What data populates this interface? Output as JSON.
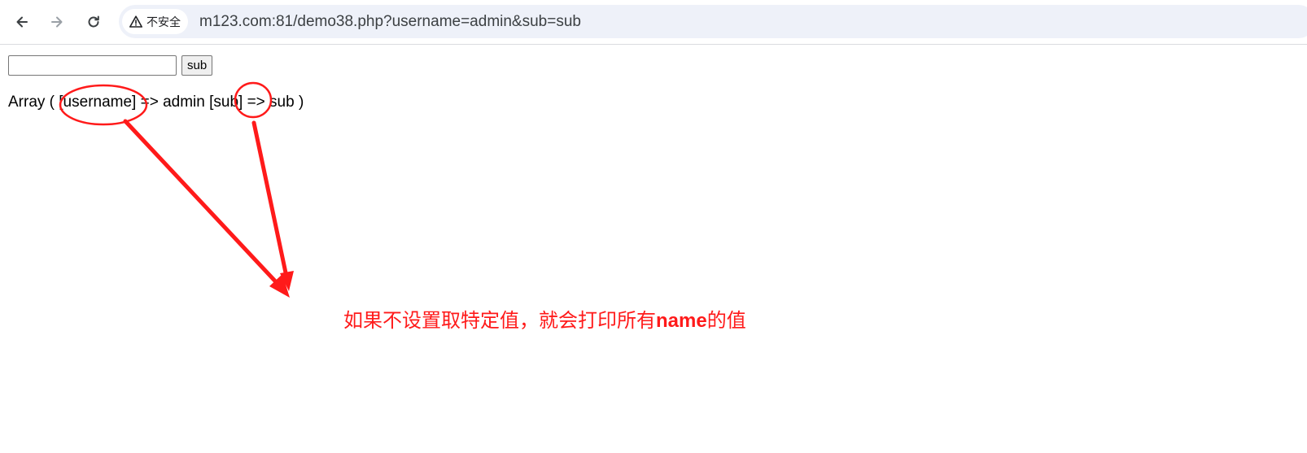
{
  "browser": {
    "nav": {
      "back_icon": "arrow-left-icon",
      "forward_icon": "arrow-right-icon",
      "reload_icon": "reload-icon"
    },
    "security_label": "不安全",
    "security_icon": "warning-triangle-icon",
    "url": "m123.com:81/demo38.php?username=admin&sub=sub"
  },
  "page": {
    "input_value": "",
    "submit_label": "sub",
    "output_text": "Array ( [username] => admin [sub] => sub )"
  },
  "annotation": {
    "note_prefix": "如果不设置取特定值，就会打印所有",
    "note_bold": "name",
    "note_suffix": "的值",
    "color": "#ff1a1a"
  }
}
